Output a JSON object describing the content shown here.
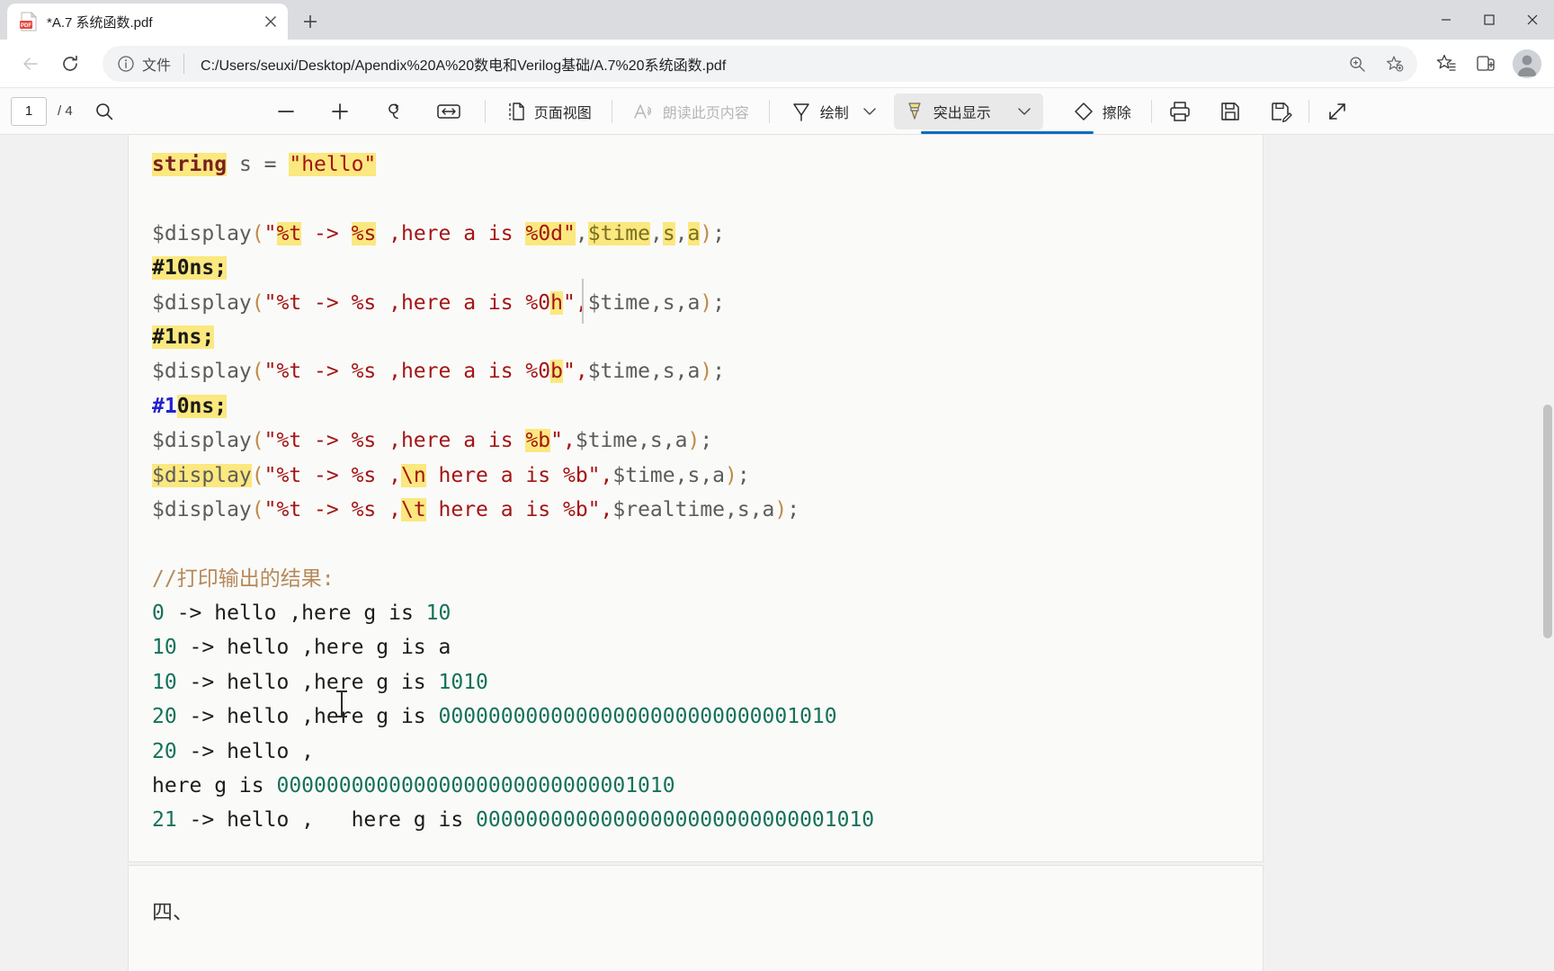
{
  "window": {
    "controls": {
      "minimize": "minimize-button",
      "maximize": "maximize-button",
      "close": "close-button"
    }
  },
  "tab": {
    "title": "*A.7 系统函数.pdf",
    "favicon": "pdf-file-icon",
    "close_label": "✕",
    "newtab_label": "+"
  },
  "navbar": {
    "back": "back-arrow-icon",
    "forward": "forward-arrow-icon",
    "reload": "reload-icon",
    "info_icon": "info-circle-icon",
    "scheme_label": "文件",
    "url": "C:/Users/seuxi/Desktop/Apendix%20A%20数电和Verilog基础/A.7%20系统函数.pdf",
    "zoom_icon": "zoom-in-icon",
    "favorite_icon": "add-favorite-star-icon",
    "collections_icon": "favorites-list-icon",
    "splitscreen_icon": "split-screen-icon",
    "profile_icon": "profile-avatar-icon"
  },
  "pdfbar": {
    "current_page": "1",
    "page_total": "/ 4",
    "search_label": "search-icon",
    "zoom_out": "−",
    "zoom_in": "+",
    "rotate": "rotate-icon",
    "fit_width": "fit-to-width-icon",
    "page_view_icon": "page-view-icon",
    "page_view_label": "页面视图",
    "read_aloud_icon": "read-aloud-icon",
    "read_aloud_label": "朗读此页内容",
    "draw_icon": "pen-icon",
    "draw_label": "绘制",
    "draw_chevron": "chevron-down-icon",
    "highlight_icon": "highlighter-icon",
    "highlight_label": "突出显示",
    "highlight_chevron": "chevron-down-icon",
    "erase_icon": "eraser-icon",
    "erase_label": "擦除",
    "print_icon": "print-icon",
    "save_icon": "save-icon",
    "save_as_icon": "save-as-icon",
    "fullscreen_icon": "expand-icon"
  },
  "document": {
    "lines": [
      {
        "id": "l1",
        "tokens": [
          {
            "t": "string",
            "c": "kw",
            "hl": true
          },
          {
            "t": " s = ",
            "c": "op"
          },
          {
            "t": "\"hello\"",
            "c": "str",
            "hl": true
          }
        ]
      },
      {
        "id": "l2",
        "blank": true
      },
      {
        "id": "l3",
        "tokens": [
          {
            "t": "$display",
            "c": "fn"
          },
          {
            "t": "(",
            "c": "paren"
          },
          {
            "t": "\"",
            "c": "str"
          },
          {
            "t": "%t",
            "c": "str",
            "hl": true
          },
          {
            "t": " -> ",
            "c": "str"
          },
          {
            "t": "%s",
            "c": "str",
            "hl": true
          },
          {
            "t": " ,here a is ",
            "c": "str"
          },
          {
            "t": "%0d\"",
            "c": "str",
            "hl": true
          },
          {
            "t": ",",
            "c": "varg"
          },
          {
            "t": "$time",
            "c": "var",
            "hl": true
          },
          {
            "t": ",",
            "c": "varg"
          },
          {
            "t": "s",
            "c": "var",
            "hl": true
          },
          {
            "t": ",",
            "c": "varg"
          },
          {
            "t": "a",
            "c": "var",
            "hl": true
          },
          {
            "t": ")",
            "c": "paren"
          },
          {
            "t": ";",
            "c": "op"
          }
        ]
      },
      {
        "id": "l4",
        "tokens": [
          {
            "t": "#10ns;",
            "c": "delay",
            "hl": true
          }
        ]
      },
      {
        "id": "l5",
        "tokens": [
          {
            "t": "$display",
            "c": "fn"
          },
          {
            "t": "(",
            "c": "paren"
          },
          {
            "t": "\"%t -> %s ,here a is %0",
            "c": "str"
          },
          {
            "t": "h",
            "c": "str",
            "hl": true
          },
          {
            "t": "\",",
            "c": "str"
          },
          {
            "t": "$time,s,a",
            "c": "varg"
          },
          {
            "t": ")",
            "c": "paren"
          },
          {
            "t": ";",
            "c": "op"
          }
        ]
      },
      {
        "id": "l6",
        "tokens": [
          {
            "t": "#1ns;",
            "c": "delay",
            "hl": true
          }
        ]
      },
      {
        "id": "l7",
        "tokens": [
          {
            "t": "$display",
            "c": "fn"
          },
          {
            "t": "(",
            "c": "paren"
          },
          {
            "t": "\"%t -> %s ,here a is %0",
            "c": "str"
          },
          {
            "t": "b",
            "c": "str",
            "hl": true
          },
          {
            "t": "\",",
            "c": "str"
          },
          {
            "t": "$time,s,a",
            "c": "varg"
          },
          {
            "t": ")",
            "c": "paren"
          },
          {
            "t": ";",
            "c": "op"
          }
        ]
      },
      {
        "id": "l8",
        "tokens": [
          {
            "t": "#1",
            "c": "delayb"
          },
          {
            "t": "0ns;",
            "c": "delay",
            "hl": true
          }
        ]
      },
      {
        "id": "l9",
        "tokens": [
          {
            "t": "$display",
            "c": "fn"
          },
          {
            "t": "(",
            "c": "paren"
          },
          {
            "t": "\"%t -> %s ,here a is ",
            "c": "str"
          },
          {
            "t": "%b",
            "c": "str",
            "hl": true
          },
          {
            "t": "\",",
            "c": "str"
          },
          {
            "t": "$time,s,a",
            "c": "varg"
          },
          {
            "t": ")",
            "c": "paren"
          },
          {
            "t": ";",
            "c": "op"
          }
        ]
      },
      {
        "id": "l10",
        "tokens": [
          {
            "t": "$display",
            "c": "fn",
            "hl": true
          },
          {
            "t": "(",
            "c": "paren"
          },
          {
            "t": "\"%t -> %s ,",
            "c": "str"
          },
          {
            "t": "\\n",
            "c": "str",
            "hl": true
          },
          {
            "t": " here a is %b\",",
            "c": "str"
          },
          {
            "t": "$time,s,a",
            "c": "varg"
          },
          {
            "t": ")",
            "c": "paren"
          },
          {
            "t": ";",
            "c": "op"
          }
        ]
      },
      {
        "id": "l11",
        "tokens": [
          {
            "t": "$display",
            "c": "fn"
          },
          {
            "t": "(",
            "c": "paren"
          },
          {
            "t": "\"%t -> %s ,",
            "c": "str"
          },
          {
            "t": "\\t",
            "c": "str",
            "hl": true
          },
          {
            "t": " here a is %b\",",
            "c": "str"
          },
          {
            "t": "$realtime,s,a",
            "c": "varg"
          },
          {
            "t": ")",
            "c": "paren"
          },
          {
            "t": ";",
            "c": "op"
          }
        ]
      },
      {
        "id": "l12",
        "blank": true
      },
      {
        "id": "l13",
        "tokens": [
          {
            "t": "//打印输出的结果:",
            "c": "comment"
          }
        ]
      },
      {
        "id": "l14",
        "tokens": [
          {
            "t": "0",
            "c": "outnum"
          },
          {
            "t": " -> hello ,here g is ",
            "c": "outtxt"
          },
          {
            "t": "10",
            "c": "outnum"
          }
        ]
      },
      {
        "id": "l15",
        "tokens": [
          {
            "t": "10",
            "c": "outnum"
          },
          {
            "t": " -> hello ,here g is a",
            "c": "outtxt"
          }
        ]
      },
      {
        "id": "l16",
        "tokens": [
          {
            "t": "10",
            "c": "outnum"
          },
          {
            "t": " -> hello ,here g is ",
            "c": "outtxt"
          },
          {
            "t": "1010",
            "c": "outnum"
          }
        ]
      },
      {
        "id": "l17",
        "tokens": [
          {
            "t": "20",
            "c": "outnum"
          },
          {
            "t": " -> hello ,here g is ",
            "c": "outtxt"
          },
          {
            "t": "00000000000000000000000000001010",
            "c": "outnum"
          }
        ]
      },
      {
        "id": "l18",
        "tokens": [
          {
            "t": "20",
            "c": "outnum"
          },
          {
            "t": " -> hello ,",
            "c": "outtxt"
          }
        ]
      },
      {
        "id": "l19",
        "tokens": [
          {
            "t": "here g is ",
            "c": "outtxt"
          },
          {
            "t": "00000000000000000000000000001010",
            "c": "outnum"
          }
        ]
      },
      {
        "id": "l20",
        "tokens": [
          {
            "t": "21",
            "c": "outnum"
          },
          {
            "t": " -> hello ,   here g is ",
            "c": "outtxt"
          },
          {
            "t": "00000000000000000000000000001010",
            "c": "outnum"
          }
        ]
      }
    ],
    "next_page_snippet": "四、"
  }
}
